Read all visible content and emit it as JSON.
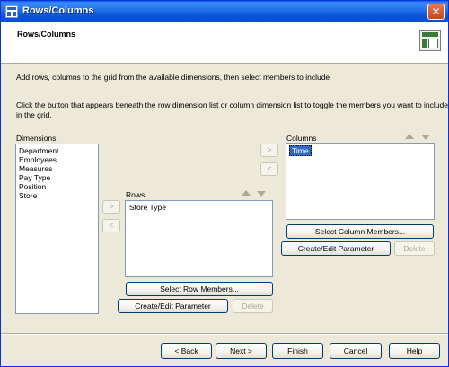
{
  "window": {
    "title": "Rows/Columns",
    "close_label": "✕"
  },
  "header": {
    "title": "Rows/Columns",
    "icon": "grid-icon"
  },
  "description": {
    "line1": "Add rows, columns to the grid from the available dimensions, then select members to include",
    "line2a": "Click the button that appears beneath the row dimension list or column dimension list to toggle the members you want to include",
    "line2b": "in the grid."
  },
  "dimensions": {
    "label": "Dimensions",
    "items": [
      "Department",
      "Employees",
      "Measures",
      "Pay Type",
      "Position",
      "Store"
    ]
  },
  "rows": {
    "label": "Rows",
    "items": [
      "Store Type"
    ],
    "select_members_label": "Select Row Members...",
    "create_param_label": "Create/Edit Parameter",
    "delete_label": "Delete"
  },
  "columns": {
    "label": "Columns",
    "items": [
      "Time"
    ],
    "select_members_label": "Select Column Members...",
    "create_param_label": "Create/Edit Parameter",
    "delete_label": "Delete"
  },
  "arrows": {
    "add": ">",
    "remove": "<"
  },
  "footer": {
    "back_label": "< Back",
    "next_label": "Next >",
    "finish_label": "Finish",
    "cancel_label": "Cancel",
    "help_label": "Help"
  },
  "colors": {
    "title_bar": "#0a54d4",
    "selection": "#316ac5",
    "window_bg": "#ece9d8"
  }
}
